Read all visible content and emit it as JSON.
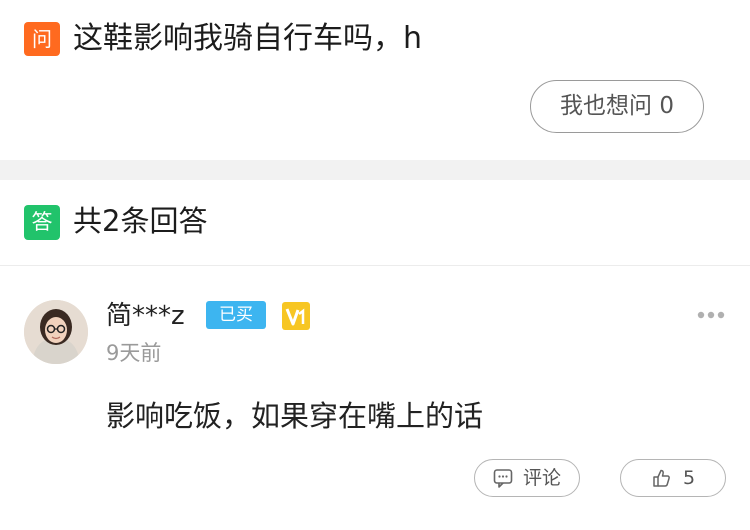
{
  "question": {
    "badge": "问",
    "text": "这鞋影响我骑自行车吗，h",
    "ask_button": "我也想问 0",
    "badge_color": "#ff6a1f"
  },
  "answers_header": {
    "badge": "答",
    "title": "共2条回答",
    "badge_color": "#21c36b"
  },
  "answer": {
    "user_name": "简***z",
    "bought_badge": "已买",
    "level_icon": "v1-level-icon",
    "time": "9天前",
    "text": "影响吃饭，如果穿在嘴上的话",
    "more_icon": "more-dots-icon",
    "comment_label": "评论",
    "comment_icon": "comment-icon",
    "like_count": "5",
    "like_icon": "thumb-up-icon"
  }
}
